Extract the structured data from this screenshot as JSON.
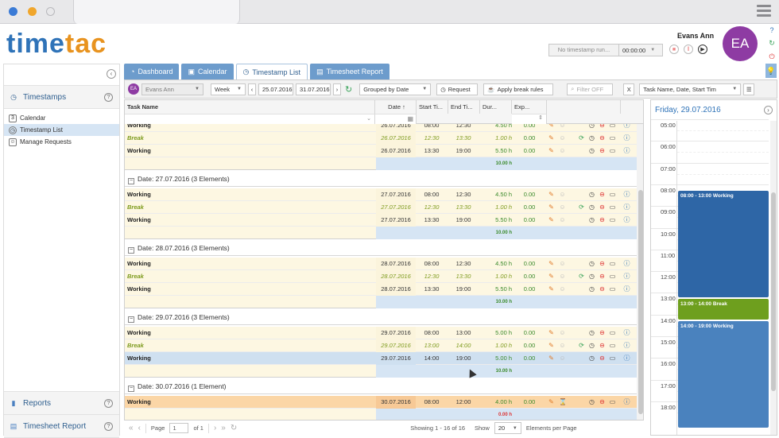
{
  "app": {
    "logo_prefix": "t",
    "logo_main": "ime",
    "logo_accent": "tac",
    "user_name": "Evans Ann",
    "user_initials": "EA"
  },
  "colors": {
    "accent": "#2f73b8",
    "logo_orange": "#e8931f",
    "avatar": "#8e3ba3",
    "work_event": "#2f68a8",
    "break_event": "#6e9f1e",
    "green_text": "#3a8a2a"
  },
  "timer": {
    "status": "No timestamp run...",
    "time": "00:00:00"
  },
  "sidebar": {
    "section_timestamps": "Timestamps",
    "items": [
      {
        "label": "Calendar"
      },
      {
        "label": "Timestamp List"
      },
      {
        "label": "Manage Requests"
      }
    ],
    "section_reports": "Reports",
    "section_timesheet": "Timesheet Report"
  },
  "tabs": [
    {
      "label": "Dashboard"
    },
    {
      "label": "Calendar"
    },
    {
      "label": "Timestamp List"
    },
    {
      "label": "Timesheet Report"
    }
  ],
  "toolbar": {
    "user": "Evans Ann",
    "period": "Week",
    "date_from": "25.07.2016",
    "date_to": "31.07.2016",
    "grouping": "Grouped by Date",
    "request_label": "Request",
    "apply_break": "Apply break rules",
    "filter_placeholder": "Filter OFF",
    "sort": "Task Name, Date, Start Tim"
  },
  "grid": {
    "columns": {
      "task": "Task Name",
      "date": "Date",
      "start": "Start Ti...",
      "end": "End Ti...",
      "dur": "Dur...",
      "exp": "Exp..."
    },
    "groups": [
      {
        "header": "",
        "rows": [
          {
            "task": "Working",
            "date": "26.07.2016",
            "start": "08:00",
            "end": "12:30",
            "dur": "4.50 h",
            "exp": "0.00",
            "type": "work"
          },
          {
            "task": "Break",
            "date": "26.07.2016",
            "start": "12:30",
            "end": "13:30",
            "dur": "1.00 h",
            "exp": "0.00",
            "type": "brk"
          },
          {
            "task": "Working",
            "date": "26.07.2016",
            "start": "13:30",
            "end": "19:00",
            "dur": "5.50 h",
            "exp": "0.00",
            "type": "work"
          }
        ],
        "sum": "10.00 h"
      },
      {
        "header": "Date: 27.07.2016 (3 Elements)",
        "rows": [
          {
            "task": "Working",
            "date": "27.07.2016",
            "start": "08:00",
            "end": "12:30",
            "dur": "4.50 h",
            "exp": "0.00",
            "type": "work"
          },
          {
            "task": "Break",
            "date": "27.07.2016",
            "start": "12:30",
            "end": "13:30",
            "dur": "1.00 h",
            "exp": "0.00",
            "type": "brk"
          },
          {
            "task": "Working",
            "date": "27.07.2016",
            "start": "13:30",
            "end": "19:00",
            "dur": "5.50 h",
            "exp": "0.00",
            "type": "work"
          }
        ],
        "sum": "10.00 h"
      },
      {
        "header": "Date: 28.07.2016 (3 Elements)",
        "rows": [
          {
            "task": "Working",
            "date": "28.07.2016",
            "start": "08:00",
            "end": "12:30",
            "dur": "4.50 h",
            "exp": "0.00",
            "type": "work"
          },
          {
            "task": "Break",
            "date": "28.07.2016",
            "start": "12:30",
            "end": "13:30",
            "dur": "1.00 h",
            "exp": "0.00",
            "type": "brk"
          },
          {
            "task": "Working",
            "date": "28.07.2016",
            "start": "13:30",
            "end": "19:00",
            "dur": "5.50 h",
            "exp": "0.00",
            "type": "work"
          }
        ],
        "sum": "10.00 h"
      },
      {
        "header": "Date: 29.07.2016 (3 Elements)",
        "rows": [
          {
            "task": "Working",
            "date": "29.07.2016",
            "start": "08:00",
            "end": "13:00",
            "dur": "5.00 h",
            "exp": "0.00",
            "type": "work"
          },
          {
            "task": "Break",
            "date": "29.07.2016",
            "start": "13:00",
            "end": "14:00",
            "dur": "1.00 h",
            "exp": "0.00",
            "type": "brk"
          },
          {
            "task": "Working",
            "date": "29.07.2016",
            "start": "14:00",
            "end": "19:00",
            "dur": "5.00 h",
            "exp": "0.00",
            "type": "sel"
          }
        ],
        "sum": "10.00 h"
      },
      {
        "header": "Date: 30.07.2016 (1 Element)",
        "rows": [
          {
            "task": "Working",
            "date": "30.07.2016",
            "start": "08:00",
            "end": "12:00",
            "dur": "4.00 h",
            "exp": "0.00",
            "type": "orange"
          }
        ],
        "sum": "0.00 h"
      }
    ]
  },
  "pager": {
    "page_label": "Page",
    "page": "1",
    "of": "of 1",
    "showing": "Showing 1 - 16 of 16",
    "show": "Show",
    "per_page": "20",
    "per_page_label": "Elements per Page"
  },
  "calendar": {
    "title": "Friday, 29.07.2016",
    "hours": [
      "05:00",
      "06:00",
      "07:00",
      "08:00",
      "09:00",
      "10:00",
      "11:00",
      "12:00",
      "13:00",
      "14:00",
      "15:00",
      "16:00",
      "17:00",
      "18:00"
    ],
    "events": [
      {
        "label": "08:00 - 13:00 Working",
        "start": 8,
        "end": 13,
        "kind": "work"
      },
      {
        "label": "13:00 - 14:00 Break",
        "start": 13,
        "end": 14,
        "kind": "break"
      },
      {
        "label": "14:00 - 19:00 Working",
        "start": 14,
        "end": 19,
        "kind": "work"
      }
    ]
  }
}
